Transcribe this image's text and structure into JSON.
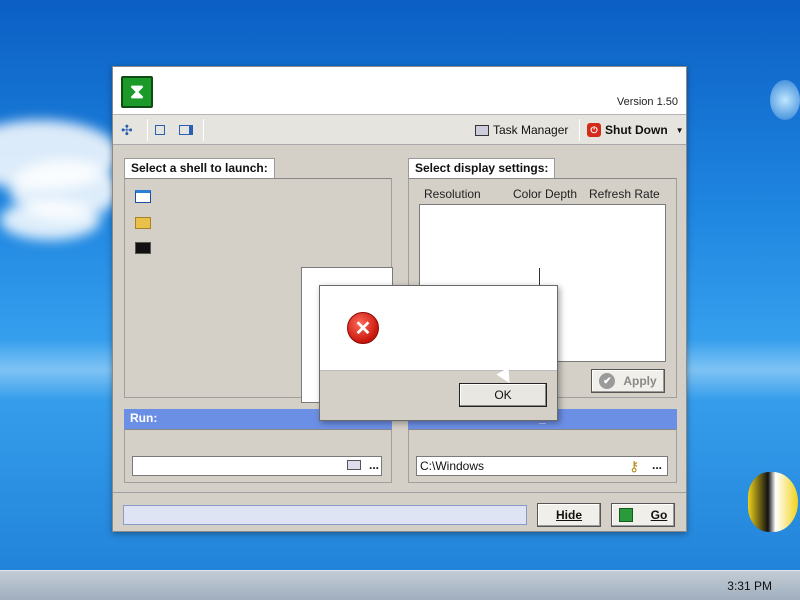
{
  "window": {
    "version": "Version 1.50"
  },
  "toolbar": {
    "task_manager": "Task Manager",
    "shut_down": "Shut Down"
  },
  "shell": {
    "title": "Select a shell to launch:"
  },
  "display": {
    "title": "Select display settings:",
    "columns": [
      "Resolution",
      "Color Depth",
      "Refresh Rate"
    ],
    "apply": "Apply"
  },
  "run": {
    "title": "Run:",
    "value": "",
    "browse": "..."
  },
  "workdir": {
    "title": "_",
    "value": "C:\\Windows",
    "browse": "..."
  },
  "footer": {
    "hide": "Hide",
    "go": "Go"
  },
  "dialog": {
    "ok": "OK"
  },
  "taskbar": {
    "clock": "3:31 PM"
  }
}
